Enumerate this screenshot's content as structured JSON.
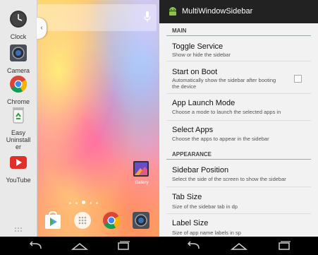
{
  "launcher": {
    "sidebar_apps": [
      {
        "label": "Clock",
        "icon": "clock-icon"
      },
      {
        "label": "Camera",
        "icon": "camera-icon"
      },
      {
        "label": "Chrome",
        "icon": "chrome-icon"
      },
      {
        "label": "Easy Uninstall er",
        "icon": "recycle-icon"
      },
      {
        "label": "YouTube",
        "icon": "youtube-icon"
      }
    ],
    "home_icons": {
      "gallery_label": "Gallery"
    },
    "dock": [
      "play-store-icon",
      "app-drawer-icon",
      "chrome-icon",
      "camera-icon"
    ]
  },
  "settings": {
    "app_title": "MultiWindowSidebar",
    "sections": [
      {
        "header": "MAIN",
        "items": [
          {
            "title": "Toggle Service",
            "summary": "Show or hide the sidebar"
          },
          {
            "title": "Start on Boot",
            "summary": "Automatically show the sidebar after booting the device",
            "checkbox": false
          },
          {
            "title": "App Launch Mode",
            "summary": "Choose a mode to launch the selected apps in"
          },
          {
            "title": "Select Apps",
            "summary": "Choose the apps to appear in the sidebar"
          }
        ]
      },
      {
        "header": "APPEARANCE",
        "items": [
          {
            "title": "Sidebar Position",
            "summary": "Select the side of the screen to show the sidebar"
          },
          {
            "title": "Tab Size",
            "summary": "Size of the sidebar tab in dp"
          },
          {
            "title": "Label Size",
            "summary": "Size of app name labels in sp"
          }
        ]
      }
    ]
  },
  "colors": {
    "action_bar": "#222222",
    "android_green": "#8bc34a",
    "navbar": "#000000"
  }
}
